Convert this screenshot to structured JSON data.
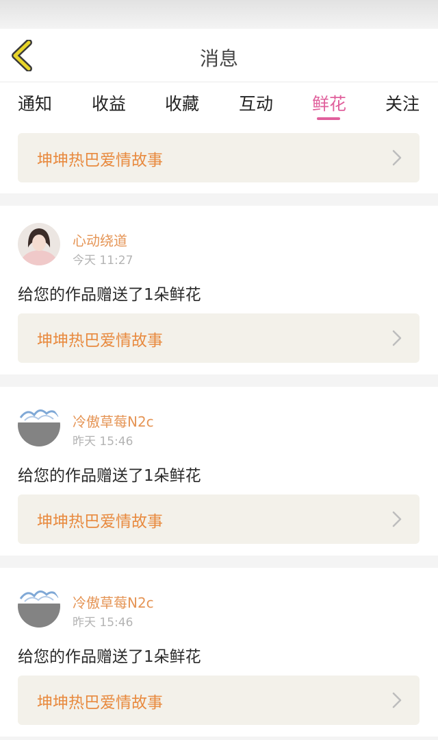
{
  "header": {
    "title": "消息",
    "back_icon": "chevron-left-icon",
    "accent": "#e8d52a"
  },
  "tabs": [
    {
      "label": "通知",
      "active": false
    },
    {
      "label": "收益",
      "active": false
    },
    {
      "label": "收藏",
      "active": false
    },
    {
      "label": "互动",
      "active": false
    },
    {
      "label": "鲜花",
      "active": true
    },
    {
      "label": "关注",
      "active": false
    }
  ],
  "active_color": "#e0609c",
  "top_work": {
    "title": "坤坤热巴爱情故事"
  },
  "messages": [
    {
      "user": "心动绕道",
      "time": "今天 11:27",
      "text": "给您的作品赠送了1朵鲜花",
      "work_title": "坤坤热巴爱情故事"
    },
    {
      "user": "冷傲草莓N2c",
      "time": "昨天 15:46",
      "text": "给您的作品赠送了1朵鲜花",
      "work_title": "坤坤热巴爱情故事"
    },
    {
      "user": "冷傲草莓N2c",
      "time": "昨天 15:46",
      "text": "给您的作品赠送了1朵鲜花",
      "work_title": "坤坤热巴爱情故事"
    }
  ]
}
